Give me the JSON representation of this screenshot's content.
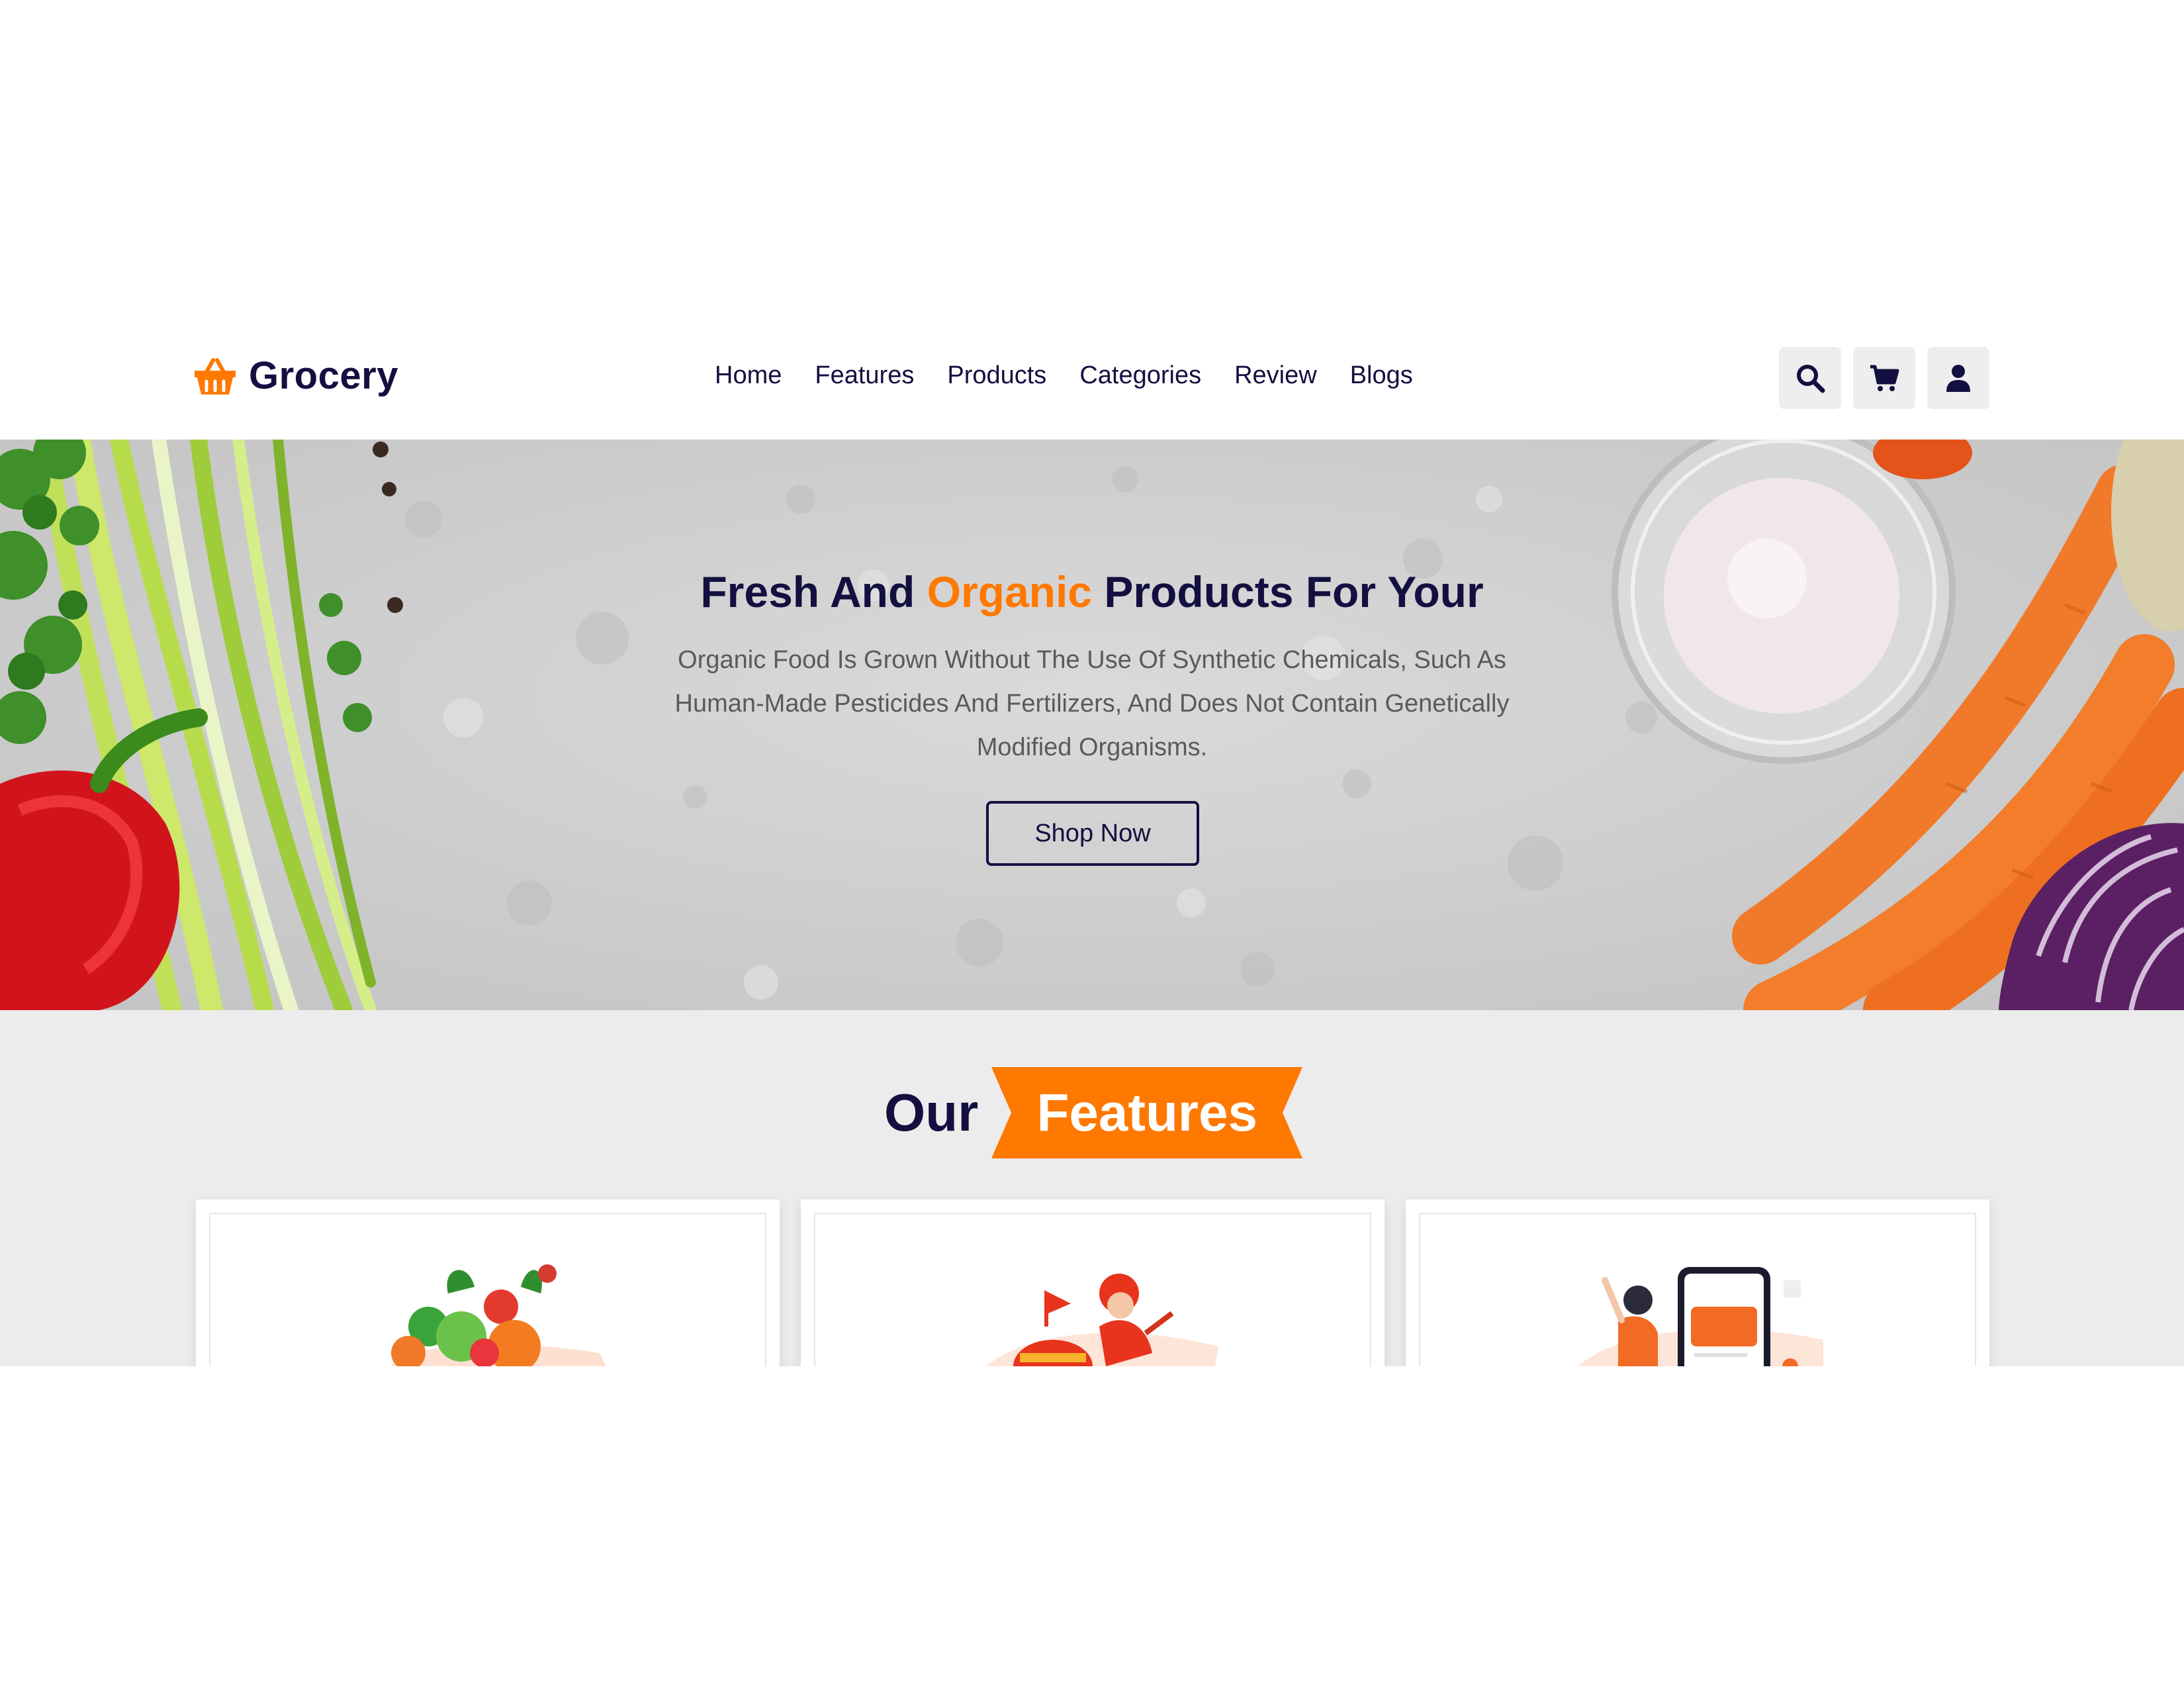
{
  "header": {
    "logo_text": "Grocery",
    "logo_icon": "shopping-basket-icon",
    "nav": [
      "Home",
      "Features",
      "Products",
      "Categories",
      "Review",
      "Blogs"
    ],
    "icons": [
      "search-icon",
      "shopping-cart-icon",
      "user-icon"
    ]
  },
  "hero": {
    "title_part1": "Fresh And ",
    "title_accent": "Organic",
    "title_part2": " Products For Your",
    "text": "Organic Food Is Grown Without The Use Of Synthetic Chemicals, Such As Human-Made Pesticides And Fertilizers, And Does Not Contain Genetically Modified Organisms.",
    "button": "Shop Now"
  },
  "features": {
    "heading_plain": "Our",
    "heading_highlight": "Features",
    "cards": [
      {
        "image": "fresh-vegetables-illustration"
      },
      {
        "image": "delivery-rider-illustration"
      },
      {
        "image": "mobile-payment-illustration"
      }
    ]
  },
  "colors": {
    "primary": "#130f40",
    "accent": "#ff7800",
    "hero_background": "#cfcfcf",
    "features_background": "#ececec",
    "icon_button_background": "#eeeeee"
  }
}
